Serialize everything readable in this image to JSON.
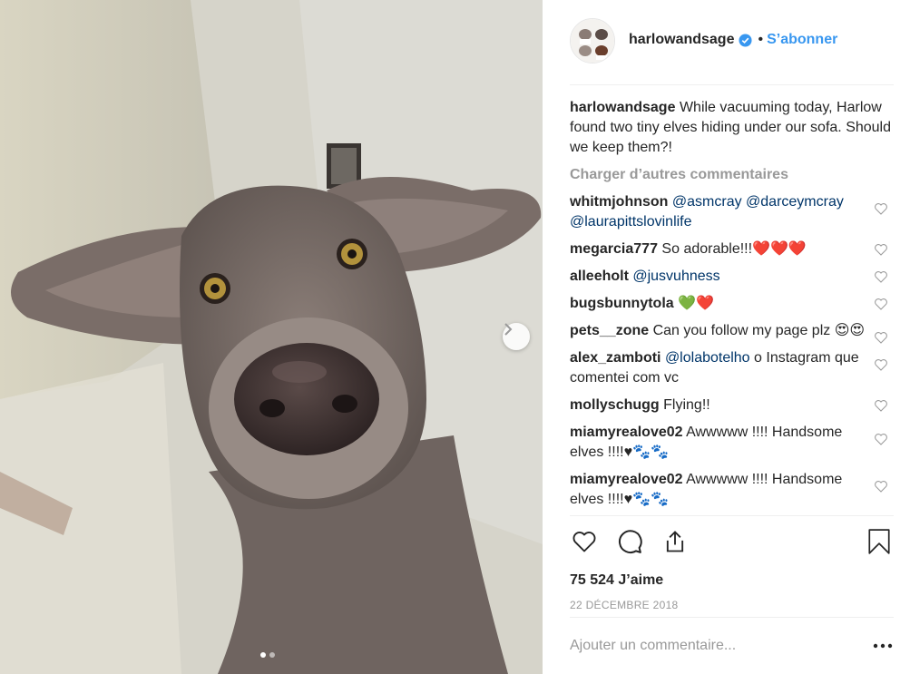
{
  "post": {
    "username": "harlowandsage",
    "follow_label": "S’abonner",
    "bullet": "•",
    "caption_user": "harlowandsage",
    "caption_text": "While vacuuming today, Harlow found two tiny elves hiding under our sofa. Should we keep them?!",
    "load_more": "Charger d’autres commentaires",
    "likes": "75 524 J’aime",
    "date": "22 DÉCEMBRE 2018",
    "comment_placeholder": "Ajouter un commentaire...",
    "accent_color": "#3897f0"
  },
  "comments": [
    {
      "user": "whitmjohnson",
      "mention": "@asmcray @darceymcray @laurapittslovinlife",
      "text": ""
    },
    {
      "user": "megarcia777",
      "mention": "",
      "text": "So adorable!!!❤️❤️❤️"
    },
    {
      "user": "alleeholt",
      "mention": "@jusvuhness",
      "text": ""
    },
    {
      "user": "bugsbunnytola",
      "mention": "",
      "text": "💚❤️"
    },
    {
      "user": "pets__zone",
      "mention": "",
      "text": "Can you follow my page plz 😍😍"
    },
    {
      "user": "alex_zamboti",
      "mention": "@lolabotelho",
      "text": "o Instagram que comentei com vc"
    },
    {
      "user": "mollyschugg",
      "mention": "",
      "text": "Flying!!"
    },
    {
      "user": "miamyrealove02",
      "mention": "",
      "text": "Awwwww !!!! Handsome elves !!!!♥🐾🐾"
    },
    {
      "user": "miamyrealove02",
      "mention": "",
      "text": "Awwwww !!!! Handsome elves !!!!♥🐾🐾"
    }
  ],
  "icons": {
    "like": "heart-icon",
    "comment": "comment-icon",
    "share": "share-icon",
    "save": "bookmark-icon",
    "more": "more-options-icon",
    "next": "chevron-right-icon",
    "verified": "verified-badge-icon"
  }
}
